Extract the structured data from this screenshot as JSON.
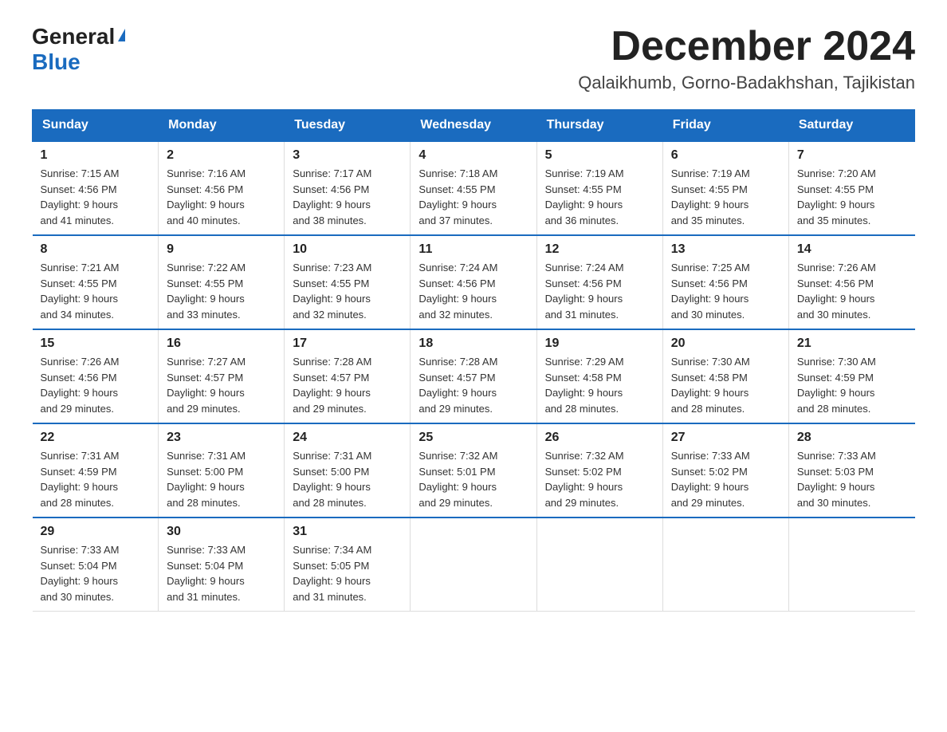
{
  "header": {
    "logo_general": "General",
    "logo_blue": "Blue",
    "month_title": "December 2024",
    "location": "Qalaikhumb, Gorno-Badakhshan, Tajikistan"
  },
  "weekdays": [
    "Sunday",
    "Monday",
    "Tuesday",
    "Wednesday",
    "Thursday",
    "Friday",
    "Saturday"
  ],
  "weeks": [
    [
      {
        "day": "1",
        "sunrise": "7:15 AM",
        "sunset": "4:56 PM",
        "daylight": "9 hours and 41 minutes."
      },
      {
        "day": "2",
        "sunrise": "7:16 AM",
        "sunset": "4:56 PM",
        "daylight": "9 hours and 40 minutes."
      },
      {
        "day": "3",
        "sunrise": "7:17 AM",
        "sunset": "4:56 PM",
        "daylight": "9 hours and 38 minutes."
      },
      {
        "day": "4",
        "sunrise": "7:18 AM",
        "sunset": "4:55 PM",
        "daylight": "9 hours and 37 minutes."
      },
      {
        "day": "5",
        "sunrise": "7:19 AM",
        "sunset": "4:55 PM",
        "daylight": "9 hours and 36 minutes."
      },
      {
        "day": "6",
        "sunrise": "7:19 AM",
        "sunset": "4:55 PM",
        "daylight": "9 hours and 35 minutes."
      },
      {
        "day": "7",
        "sunrise": "7:20 AM",
        "sunset": "4:55 PM",
        "daylight": "9 hours and 35 minutes."
      }
    ],
    [
      {
        "day": "8",
        "sunrise": "7:21 AM",
        "sunset": "4:55 PM",
        "daylight": "9 hours and 34 minutes."
      },
      {
        "day": "9",
        "sunrise": "7:22 AM",
        "sunset": "4:55 PM",
        "daylight": "9 hours and 33 minutes."
      },
      {
        "day": "10",
        "sunrise": "7:23 AM",
        "sunset": "4:55 PM",
        "daylight": "9 hours and 32 minutes."
      },
      {
        "day": "11",
        "sunrise": "7:24 AM",
        "sunset": "4:56 PM",
        "daylight": "9 hours and 32 minutes."
      },
      {
        "day": "12",
        "sunrise": "7:24 AM",
        "sunset": "4:56 PM",
        "daylight": "9 hours and 31 minutes."
      },
      {
        "day": "13",
        "sunrise": "7:25 AM",
        "sunset": "4:56 PM",
        "daylight": "9 hours and 30 minutes."
      },
      {
        "day": "14",
        "sunrise": "7:26 AM",
        "sunset": "4:56 PM",
        "daylight": "9 hours and 30 minutes."
      }
    ],
    [
      {
        "day": "15",
        "sunrise": "7:26 AM",
        "sunset": "4:56 PM",
        "daylight": "9 hours and 29 minutes."
      },
      {
        "day": "16",
        "sunrise": "7:27 AM",
        "sunset": "4:57 PM",
        "daylight": "9 hours and 29 minutes."
      },
      {
        "day": "17",
        "sunrise": "7:28 AM",
        "sunset": "4:57 PM",
        "daylight": "9 hours and 29 minutes."
      },
      {
        "day": "18",
        "sunrise": "7:28 AM",
        "sunset": "4:57 PM",
        "daylight": "9 hours and 29 minutes."
      },
      {
        "day": "19",
        "sunrise": "7:29 AM",
        "sunset": "4:58 PM",
        "daylight": "9 hours and 28 minutes."
      },
      {
        "day": "20",
        "sunrise": "7:30 AM",
        "sunset": "4:58 PM",
        "daylight": "9 hours and 28 minutes."
      },
      {
        "day": "21",
        "sunrise": "7:30 AM",
        "sunset": "4:59 PM",
        "daylight": "9 hours and 28 minutes."
      }
    ],
    [
      {
        "day": "22",
        "sunrise": "7:31 AM",
        "sunset": "4:59 PM",
        "daylight": "9 hours and 28 minutes."
      },
      {
        "day": "23",
        "sunrise": "7:31 AM",
        "sunset": "5:00 PM",
        "daylight": "9 hours and 28 minutes."
      },
      {
        "day": "24",
        "sunrise": "7:31 AM",
        "sunset": "5:00 PM",
        "daylight": "9 hours and 28 minutes."
      },
      {
        "day": "25",
        "sunrise": "7:32 AM",
        "sunset": "5:01 PM",
        "daylight": "9 hours and 29 minutes."
      },
      {
        "day": "26",
        "sunrise": "7:32 AM",
        "sunset": "5:02 PM",
        "daylight": "9 hours and 29 minutes."
      },
      {
        "day": "27",
        "sunrise": "7:33 AM",
        "sunset": "5:02 PM",
        "daylight": "9 hours and 29 minutes."
      },
      {
        "day": "28",
        "sunrise": "7:33 AM",
        "sunset": "5:03 PM",
        "daylight": "9 hours and 30 minutes."
      }
    ],
    [
      {
        "day": "29",
        "sunrise": "7:33 AM",
        "sunset": "5:04 PM",
        "daylight": "9 hours and 30 minutes."
      },
      {
        "day": "30",
        "sunrise": "7:33 AM",
        "sunset": "5:04 PM",
        "daylight": "9 hours and 31 minutes."
      },
      {
        "day": "31",
        "sunrise": "7:34 AM",
        "sunset": "5:05 PM",
        "daylight": "9 hours and 31 minutes."
      },
      null,
      null,
      null,
      null
    ]
  ]
}
